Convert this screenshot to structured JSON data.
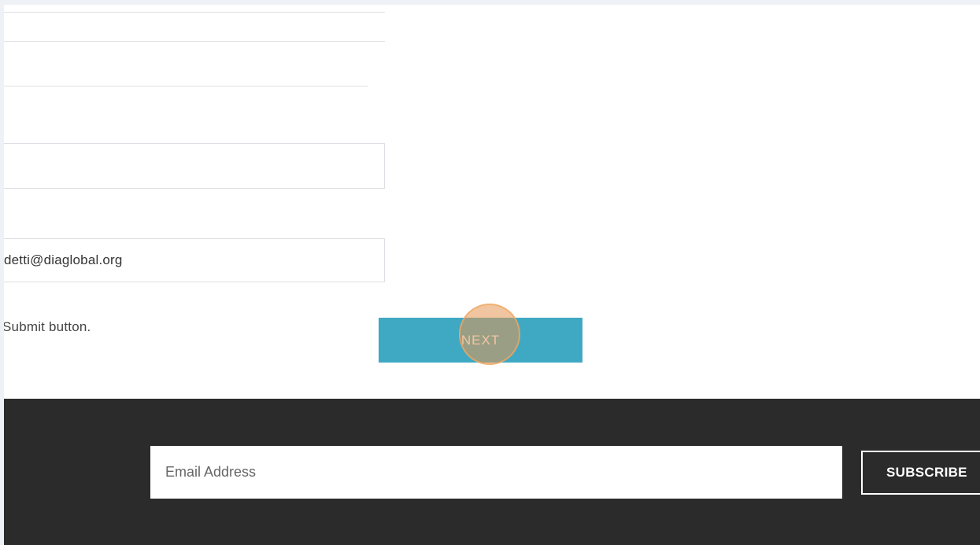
{
  "form": {
    "email_value": "detti@diaglobal.org",
    "instruction_text": "Submit button.",
    "next_label": "NEXT"
  },
  "footer": {
    "newsletter": {
      "email_placeholder": "Email Address",
      "subscribe_label": "SUBSCRIBE"
    }
  },
  "colors": {
    "page_background": "#eef2f6",
    "next_button": "#3fa9c4",
    "footer_background": "#2b2b2b",
    "click_indicator": "#e49650"
  }
}
